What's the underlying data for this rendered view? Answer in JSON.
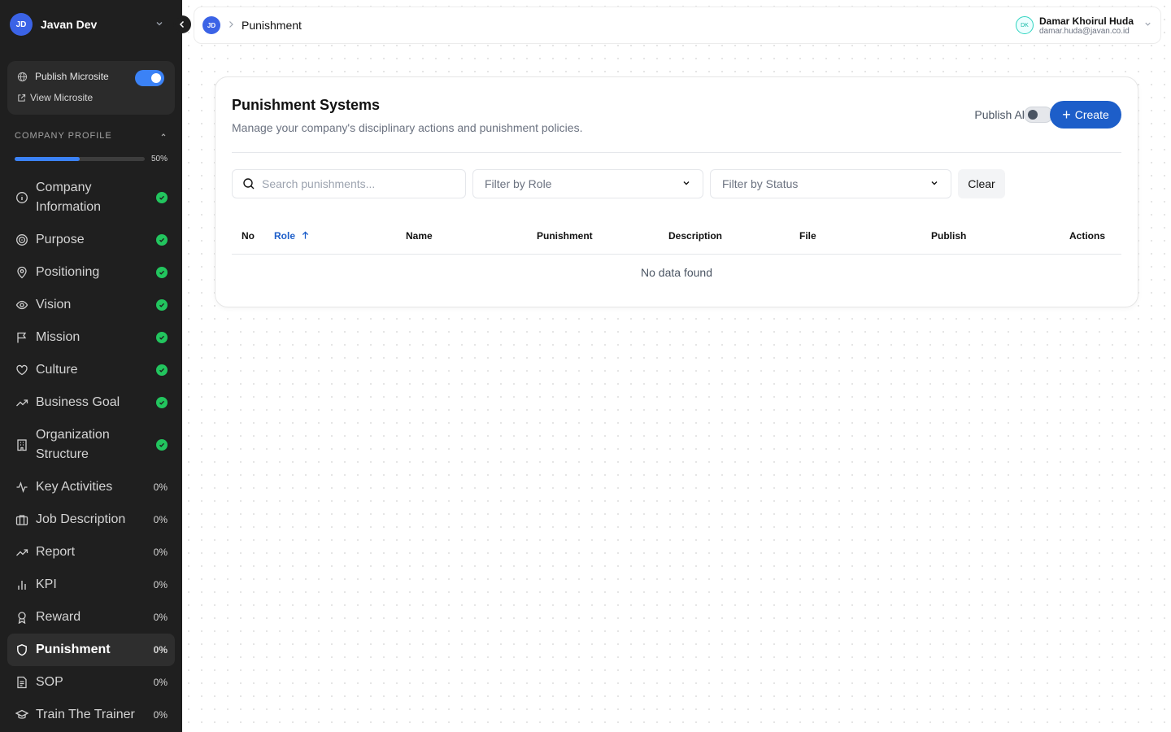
{
  "sidebar": {
    "user_initials": "JD",
    "user_name": "Javan Dev",
    "publish_microsite": "Publish Microsite",
    "view_microsite": "View Microsite",
    "section_title": "COMPANY PROFILE",
    "progress_label": "50%",
    "progress_value": 0.5,
    "items": [
      {
        "label": "Company Information",
        "icon": "info-icon",
        "done": true
      },
      {
        "label": "Purpose",
        "icon": "target-icon",
        "done": true
      },
      {
        "label": "Positioning",
        "icon": "map-pin-icon",
        "done": true
      },
      {
        "label": "Vision",
        "icon": "eye-icon",
        "done": true
      },
      {
        "label": "Mission",
        "icon": "flag-icon",
        "done": true
      },
      {
        "label": "Culture",
        "icon": "heart-icon",
        "done": true
      },
      {
        "label": "Business Goal",
        "icon": "trending-up-icon",
        "done": true
      },
      {
        "label": "Organization Structure",
        "icon": "building-icon",
        "done": true
      },
      {
        "label": "Key Activities",
        "icon": "activity-icon",
        "pct": "0%"
      },
      {
        "label": "Job Description",
        "icon": "briefcase-icon",
        "pct": "0%"
      },
      {
        "label": "Report",
        "icon": "trending-up-icon",
        "pct": "0%"
      },
      {
        "label": "KPI",
        "icon": "bar-chart-icon",
        "pct": "0%"
      },
      {
        "label": "Reward",
        "icon": "award-icon",
        "pct": "0%"
      },
      {
        "label": "Punishment",
        "icon": "shield-icon",
        "pct": "0%"
      },
      {
        "label": "SOP",
        "icon": "file-text-icon",
        "pct": "0%"
      },
      {
        "label": "Train The Trainer",
        "icon": "graduation-cap-icon",
        "pct": "0%"
      }
    ]
  },
  "topbar": {
    "breadcrumb_initials": "JD",
    "breadcrumb_current": "Punishment",
    "user_initials": "DK",
    "user_name": "Damar Khoirul Huda",
    "user_email": "damar.huda@javan.co.id"
  },
  "main": {
    "title": "Punishment Systems",
    "subtitle": "Manage your company's disciplinary actions and punishment policies.",
    "publish_all_label": "Publish All",
    "create_label": "Create",
    "search_placeholder": "Search punishments...",
    "filter_role": "Filter by Role",
    "filter_status": "Filter by Status",
    "clear_label": "Clear",
    "table": {
      "columns": [
        "No",
        "Role",
        "Name",
        "Punishment",
        "Description",
        "File",
        "Publish",
        "Actions"
      ],
      "empty_text": "No data found"
    }
  },
  "colors": {
    "accent": "#1d5ec9",
    "sidebar_bg": "#1f1f1f",
    "success": "#22c55e"
  }
}
